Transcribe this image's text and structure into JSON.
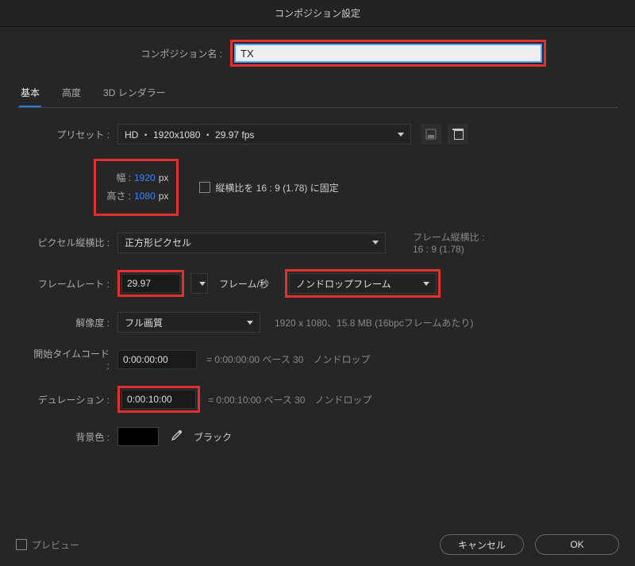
{
  "title": "コンポジション設定",
  "name": {
    "label": "コンポジション名 :",
    "value": "TX"
  },
  "tabs": {
    "basic": "基本",
    "advanced": "高度",
    "renderer": "3D レンダラー"
  },
  "preset": {
    "label": "プリセット :",
    "value": "HD ・ 1920x1080 ・ 29.97 fps"
  },
  "dims": {
    "width_label": "幅 :",
    "width_value": "1920",
    "width_suffix": "px",
    "height_label": "高さ :",
    "height_value": "1080",
    "height_suffix": "px"
  },
  "lock_ratio": {
    "label": "縦横比を 16 : 9 (1.78) に固定"
  },
  "par": {
    "label": "ピクセル縦横比 :",
    "value": "正方形ピクセル"
  },
  "far": {
    "label": "フレーム縦横比 :",
    "value": "16 : 9 (1.78)"
  },
  "framerate": {
    "label": "フレームレート :",
    "value": "29.97",
    "suffix": "フレーム/秒"
  },
  "drop": {
    "value": "ノンドロップフレーム"
  },
  "resolution": {
    "label": "解像度 :",
    "value": "フル画質",
    "info": "1920 x 1080、15.8 MB (16bpcフレームあたり)"
  },
  "start_tc": {
    "label": "開始タイムコード :",
    "value": "0:00:00:00",
    "info": "= 0:00:00:00  ベース 30　ノンドロップ"
  },
  "duration": {
    "label": "デュレーション :",
    "value": "0:00:10:00",
    "info": "= 0:00:10:00  ベース 30　ノンドロップ"
  },
  "bgcolor": {
    "label": "背景色 :",
    "name": "ブラック"
  },
  "footer": {
    "preview": "プレビュー",
    "cancel": "キャンセル",
    "ok": "OK"
  }
}
